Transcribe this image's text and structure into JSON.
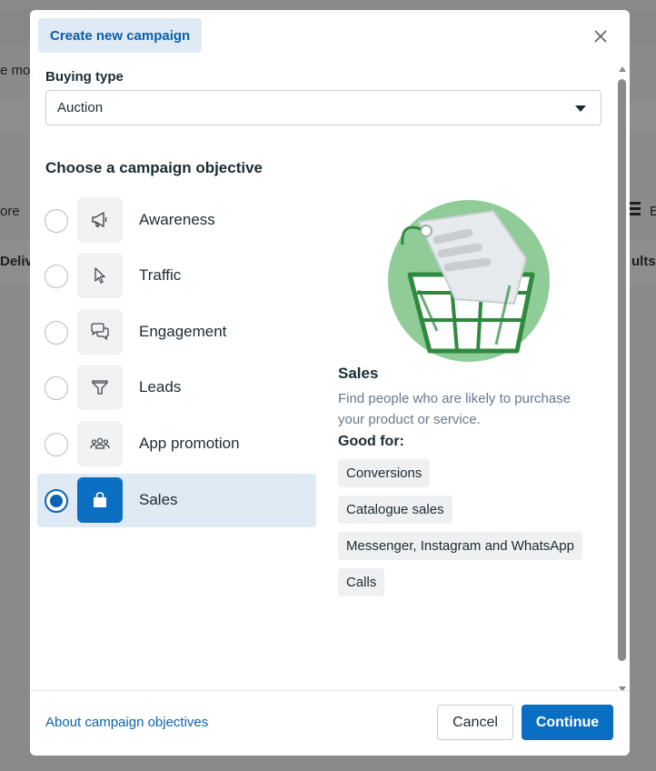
{
  "background": {
    "frag_top": "e mo",
    "frag_left_mid": "ore",
    "frag_left_col": "Delive",
    "frag_right_col": "ults",
    "frag_right_mid": "E"
  },
  "modal": {
    "title": "Create new campaign",
    "close_icon": "close-icon"
  },
  "buying_type": {
    "label": "Buying type",
    "value": "Auction"
  },
  "objective_section": {
    "title": "Choose a campaign objective",
    "items": [
      {
        "label": "Awareness",
        "icon": "megaphone-icon",
        "selected": false
      },
      {
        "label": "Traffic",
        "icon": "cursor-icon",
        "selected": false
      },
      {
        "label": "Engagement",
        "icon": "chat-bubbles-icon",
        "selected": false
      },
      {
        "label": "Leads",
        "icon": "funnel-icon",
        "selected": false
      },
      {
        "label": "App promotion",
        "icon": "people-group-icon",
        "selected": false
      },
      {
        "label": "Sales",
        "icon": "shopping-bag-icon",
        "selected": true
      }
    ]
  },
  "details": {
    "title": "Sales",
    "description": "Find people who are likely to purchase your product or service.",
    "good_for_label": "Good for:",
    "chips": [
      "Conversions",
      "Catalogue sales",
      "Messenger, Instagram and WhatsApp",
      "Calls"
    ]
  },
  "footer": {
    "link": "About campaign objectives",
    "cancel": "Cancel",
    "continue": "Continue"
  },
  "colors": {
    "accent": "#0a6fc2",
    "selected_bg": "#dfeaf5",
    "illustration_green": "#8fcc98"
  }
}
